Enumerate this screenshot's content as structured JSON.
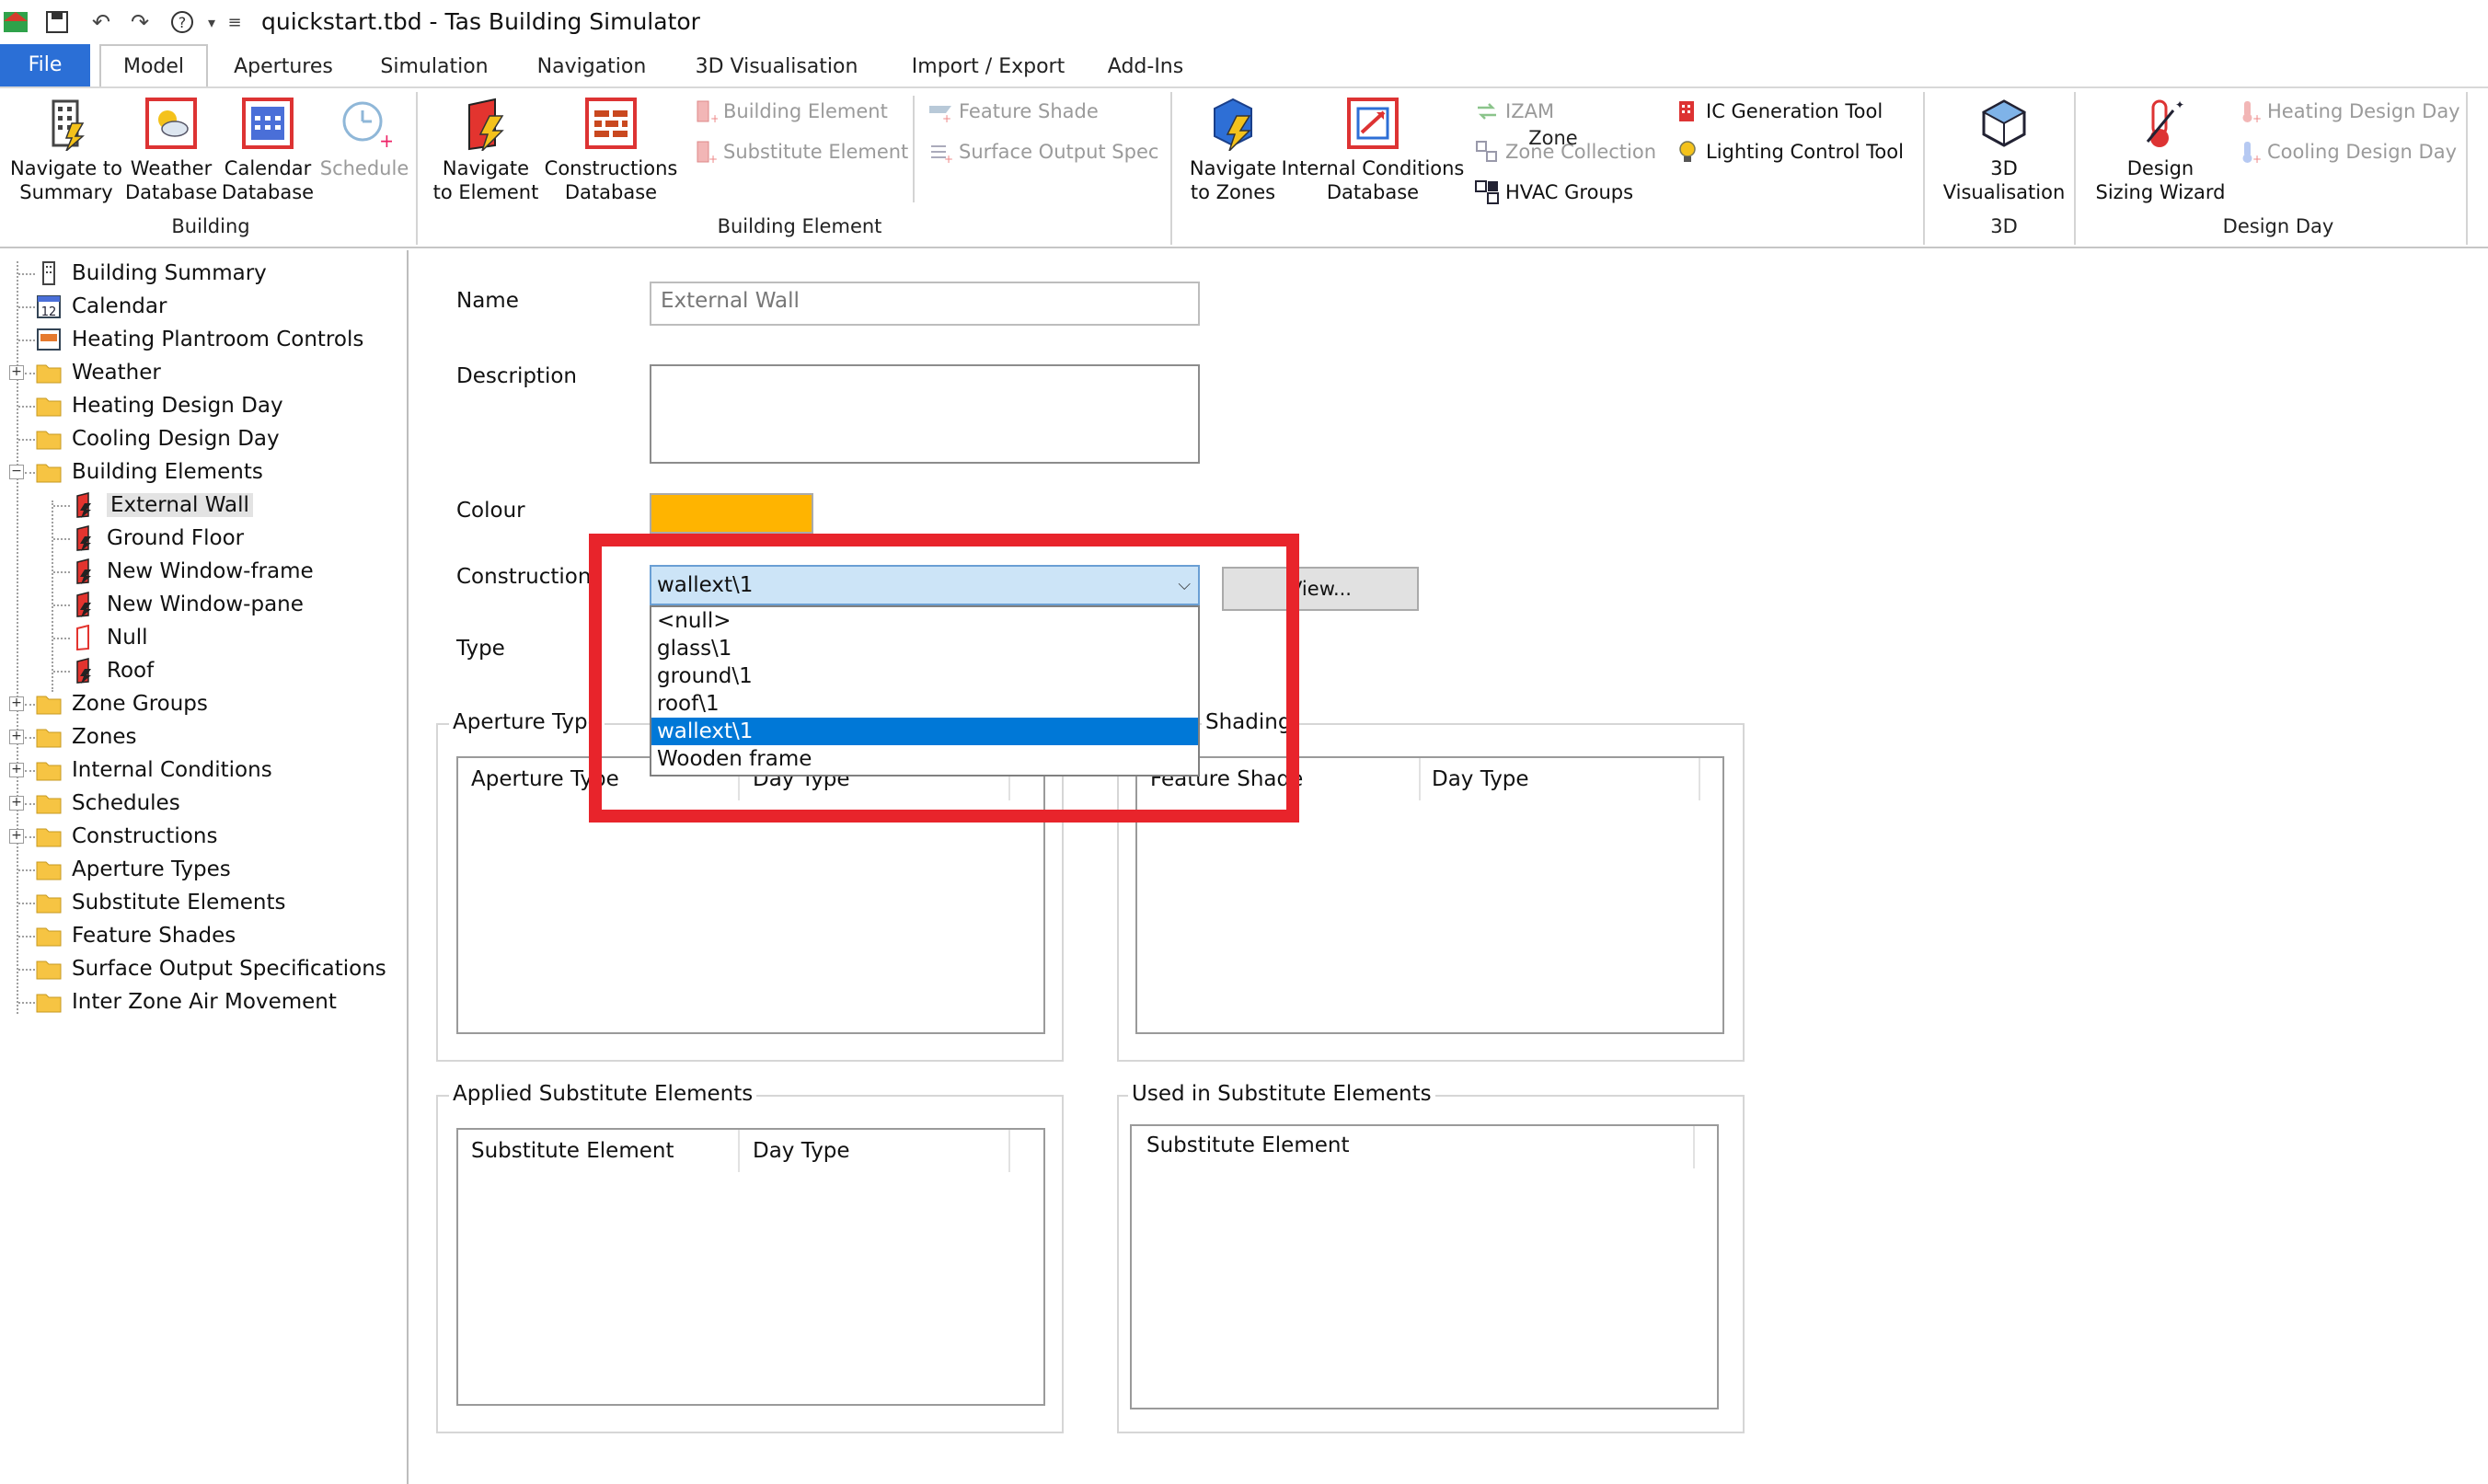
{
  "app": {
    "title": "quickstart.tbd - Tas Building Simulator"
  },
  "tabs": [
    "File",
    "Model",
    "Apertures",
    "Simulation",
    "Navigation",
    "3D Visualisation",
    "Import / Export",
    "Add-Ins"
  ],
  "ribbon": {
    "building": {
      "group": "Building",
      "nav_summary": [
        "Navigate to",
        "Summary"
      ],
      "weather_db": [
        "Weather",
        "Database"
      ],
      "calendar_db": [
        "Calendar",
        "Database"
      ],
      "schedule": "Schedule"
    },
    "building_element": {
      "group": "Building Element",
      "nav_element": [
        "Navigate",
        "to Element"
      ],
      "constructions_db": [
        "Constructions",
        "Database"
      ],
      "building_element": "Building Element",
      "substitute_element": "Substitute Element",
      "feature_shade": "Feature Shade",
      "surface_output_spec": "Surface Output Spec"
    },
    "zone": {
      "group": "Zone",
      "nav_zones": [
        "Navigate",
        "to Zones"
      ],
      "ic_db": [
        "Internal Conditions",
        "Database"
      ],
      "izam": "IZAM",
      "zone_collection": "Zone Collection",
      "hvac_groups": "HVAC Groups",
      "ic_tool": "IC Generation Tool",
      "lighting_tool": "Lighting Control Tool"
    },
    "threed": {
      "group": "3D",
      "vis": [
        "3D",
        "Visualisation"
      ]
    },
    "design_day": {
      "group": "Design Day",
      "wizard": [
        "Design",
        "Sizing Wizard"
      ],
      "heating": "Heating Design Day",
      "cooling": "Cooling Design Day"
    }
  },
  "tree": {
    "building_summary": "Building Summary",
    "calendar": "Calendar",
    "heating_plantroom": "Heating Plantroom Controls",
    "weather": "Weather",
    "heating_design_day": "Heating Design Day",
    "cooling_design_day": "Cooling Design Day",
    "building_elements": "Building Elements",
    "external_wall": "External Wall",
    "ground_floor": "Ground Floor",
    "window_frame": "New Window-frame",
    "window_pane": "New Window-pane",
    "null": "Null",
    "roof": "Roof",
    "zone_groups": "Zone Groups",
    "zones": "Zones",
    "internal_conditions": "Internal Conditions",
    "schedules": "Schedules",
    "constructions": "Constructions",
    "aperture_types": "Aperture Types",
    "substitute_elements": "Substitute Elements",
    "feature_shades": "Feature Shades",
    "surface_output_specs": "Surface Output Specifications",
    "inter_zone_air": "Inter Zone Air Movement"
  },
  "form": {
    "name_label": "Name",
    "name_value": "External Wall",
    "description_label": "Description",
    "colour_label": "Colour",
    "colour_value": "#ffb400",
    "construction_label": "Construction",
    "construction_value": "wallext\\1",
    "type_label": "Type",
    "view_button": "View...",
    "construction_options": [
      "<null>",
      "glass\\1",
      "ground\\1",
      "roof\\1",
      "wallext\\1",
      "Wooden frame"
    ],
    "aperture_group": "Aperture Type",
    "aperture_col1": "Aperture Type",
    "aperture_col2": "Day Type",
    "shading_group": "Shading",
    "shading_col1": "Feature Shade",
    "shading_col2": "Day Type",
    "applied_sub_group": "Applied Substitute Elements",
    "applied_sub_col1": "Substitute Element",
    "applied_sub_col2": "Day Type",
    "used_sub_group": "Used in Substitute Elements",
    "used_sub_col1": "Substitute Element"
  },
  "colors": {
    "file_tab": "#2b6fd6",
    "highlight": "#e8242b",
    "selection": "#0078d7"
  }
}
